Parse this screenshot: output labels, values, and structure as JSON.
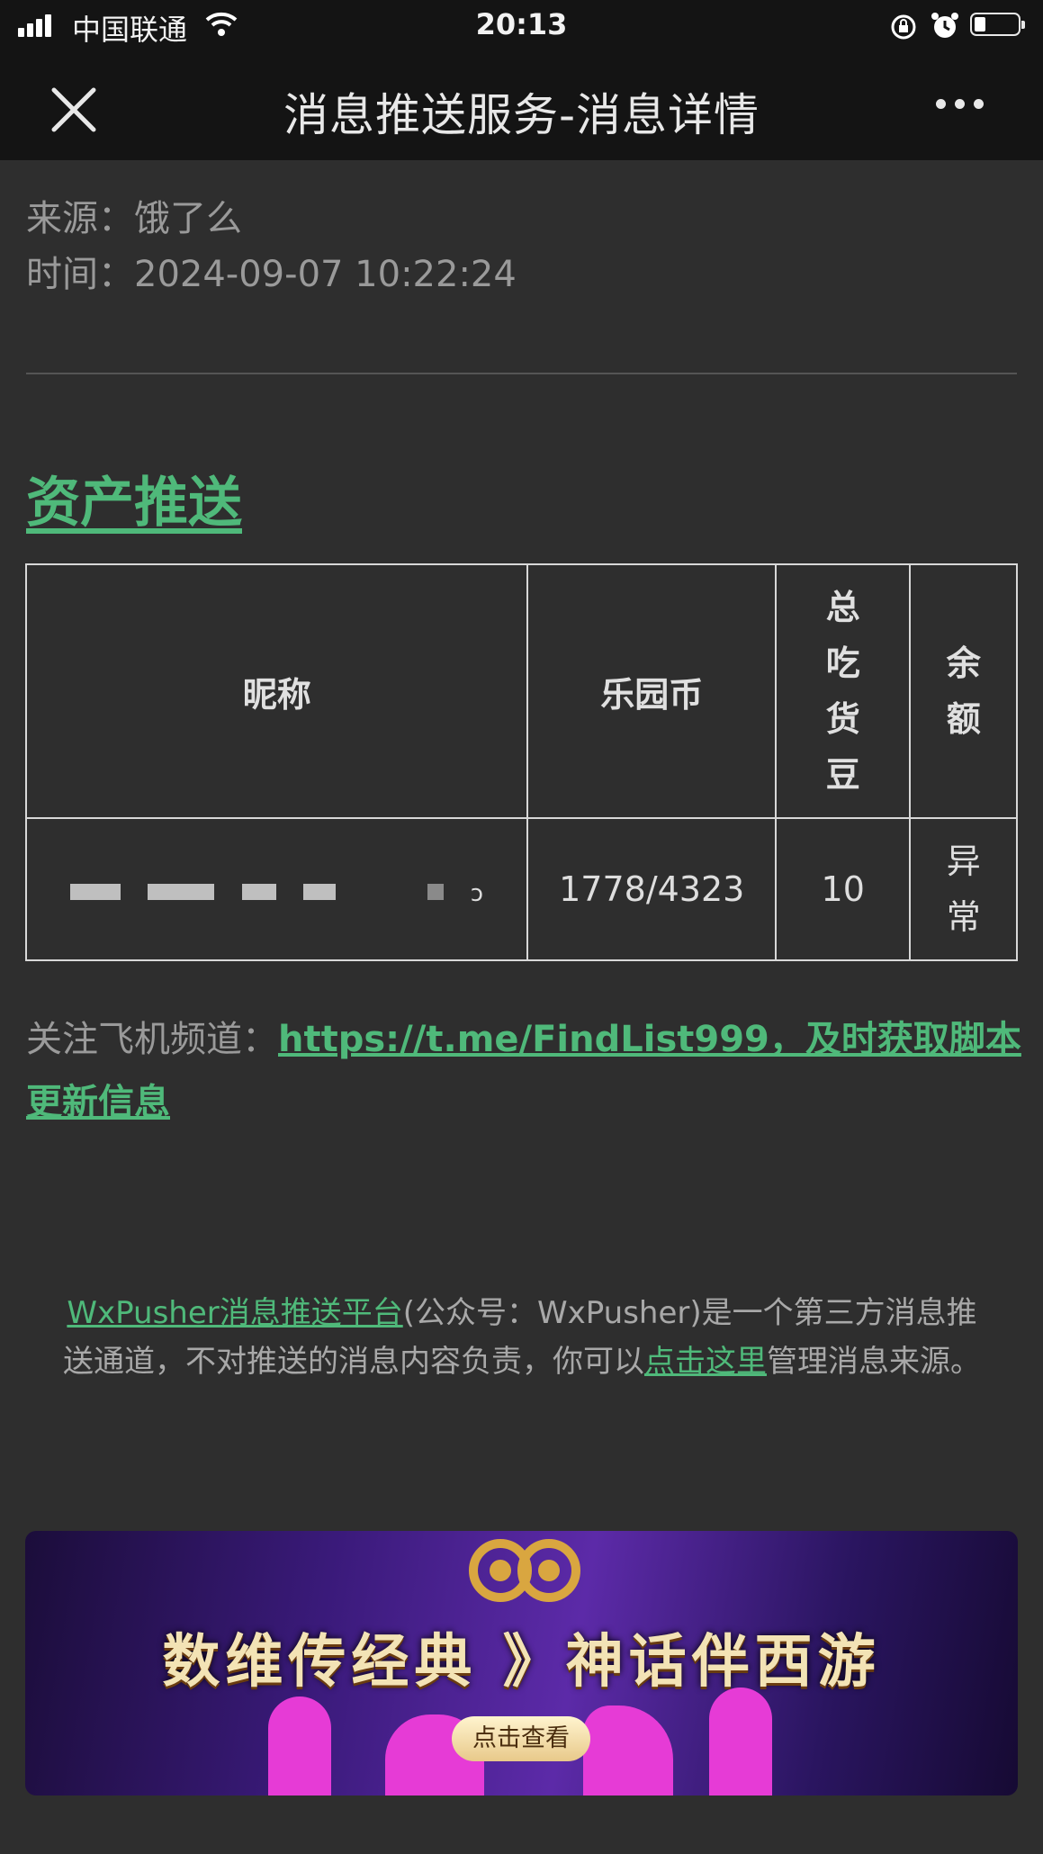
{
  "status_bar": {
    "carrier": "中国联通",
    "time": "20:13"
  },
  "nav": {
    "title": "消息推送服务-消息详情"
  },
  "meta": {
    "source_label": "来源：",
    "source_value": "饿了么",
    "time_label": "时间：",
    "time_value": "2024-09-07 10:22:24"
  },
  "content": {
    "heading": "资产推送",
    "table": {
      "headers": [
        "昵称",
        "乐园币",
        "总吃货豆",
        "余额"
      ],
      "rows": [
        {
          "nickname_tail": "ɔ",
          "coins": "1778/4323",
          "beans": "10",
          "balance": "异常"
        }
      ]
    },
    "follow_label": "关注飞机频道：",
    "follow_link": "https://t.me/FindList999，及时获取脚本更新信息"
  },
  "footer": {
    "platform_link": "WxPusher消息推送平台",
    "text_1": "(公众号：WxPusher)是一个第三方消息推送通道，不对推送的消息内容负责，你可以",
    "manage_link": "点击这里",
    "text_2": "管理消息来源。"
  },
  "banner": {
    "title": "数维传经典 》神话伴西游",
    "button": "点击查看",
    "colors": {
      "primary": "#5c2aa8",
      "accent": "#e63bd6"
    }
  },
  "colors": {
    "link_green": "#4fb97a",
    "background": "#2e2e2e",
    "bar": "#141414"
  }
}
